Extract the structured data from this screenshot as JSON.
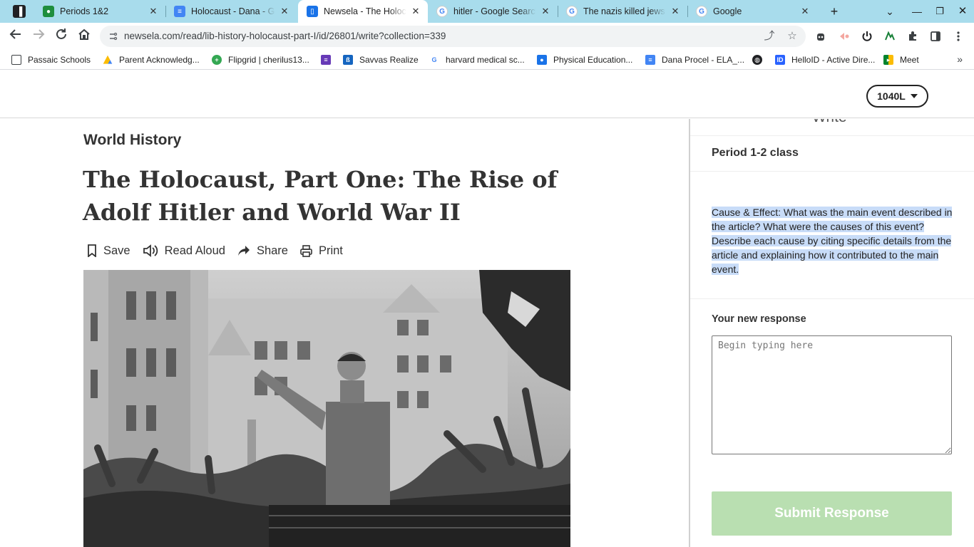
{
  "browser": {
    "tabs": [
      {
        "title": "Periods 1&2",
        "favicon": "classroom-icon",
        "color": "#1e8e3e"
      },
      {
        "title": "Holocaust - Dana - Go",
        "favicon": "docs-icon",
        "color": "#4285f4"
      },
      {
        "title": "Newsela - The Holoca",
        "favicon": "newsela-icon",
        "color": "#1a73e8",
        "active": true
      },
      {
        "title": "hitler - Google Search",
        "favicon": "google-icon",
        "color": "#4285f4"
      },
      {
        "title": "The nazis killed jews f",
        "favicon": "google-icon",
        "color": "#4285f4"
      },
      {
        "title": "Google",
        "favicon": "google-icon",
        "color": "#4285f4"
      }
    ],
    "address": {
      "url": "newsela.com/read/lib-history-holocaust-part-I/id/26801/write?collection=339"
    },
    "bookmarks": [
      {
        "label": "Passaic Schools",
        "icon": "folder-icon"
      },
      {
        "label": "Parent Acknowledg...",
        "icon": "drive-icon"
      },
      {
        "label": "Flipgrid | cherilus13...",
        "icon": "flipgrid-icon"
      },
      {
        "label": "",
        "icon": "forms-icon"
      },
      {
        "label": "Savvas Realize",
        "icon": "savvas-icon"
      },
      {
        "label": "harvard medical sc...",
        "icon": "google-icon"
      },
      {
        "label": "Physical Education...",
        "icon": "classroom-icon"
      },
      {
        "label": "Dana Procel - ELA_...",
        "icon": "docs-icon"
      },
      {
        "label": "",
        "icon": "globe-icon"
      },
      {
        "label": "HelloID - Active Dire...",
        "icon": "helloid-icon"
      },
      {
        "label": "Meet",
        "icon": "meet-icon"
      }
    ]
  },
  "header": {
    "level": "1040L"
  },
  "article": {
    "subject": "World History",
    "title": "The Holocaust, Part One: The Rise of Adolf Hitler and World War II",
    "actions": {
      "save": "Save",
      "read_aloud": "Read Aloud",
      "share": "Share",
      "print": "Print"
    }
  },
  "panel": {
    "heading": "Write",
    "class_name": "Period 1-2 class",
    "prompt": "Cause & Effect: What was the main event described in the article? What were the causes of this event? Describe each cause by citing specific details from the article and explaining how it contributed to the main event.",
    "response_label": "Your new response",
    "response_placeholder": "Begin typing here",
    "response_value": "",
    "submit_label": "Submit Response"
  },
  "colors": {
    "tabstrip": "#a8dcec",
    "selection": "#c8dcf8",
    "submit_disabled": "#b9dfb1"
  }
}
